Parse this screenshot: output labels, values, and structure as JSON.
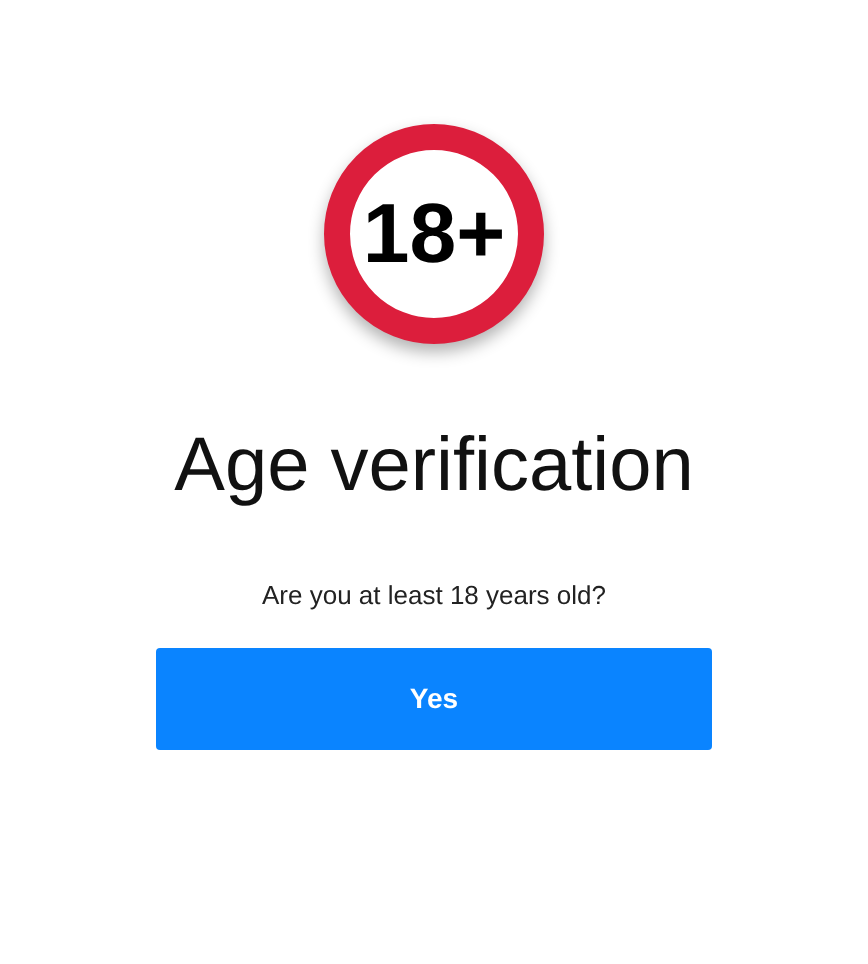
{
  "badge": {
    "text": "18+"
  },
  "title": "Age verification",
  "question": "Are you at least 18 years old?",
  "buttons": [
    {
      "label": "Yes"
    }
  ]
}
